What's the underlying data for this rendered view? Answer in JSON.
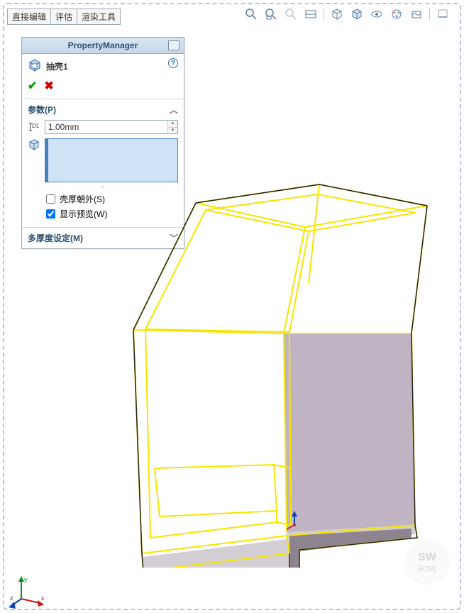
{
  "tabs": [
    "直接编辑",
    "评估",
    "渲染工具"
  ],
  "pm": {
    "title": "PropertyManager",
    "feature_name": "抽壳1",
    "help": "?",
    "params_section": "参数(P)",
    "thickness": "1.00mm",
    "shell_outward": "壳厚朝外(S)",
    "show_preview": "显示预览(W)",
    "multi_thickness": "多厚度设定(M)"
  },
  "axes": {
    "x": "x",
    "y": "y",
    "z": "z"
  }
}
